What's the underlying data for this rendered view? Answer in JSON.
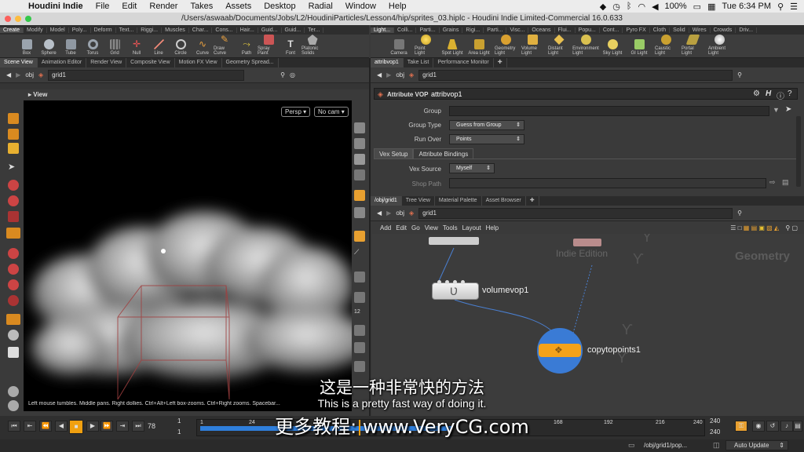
{
  "menubar": {
    "apple": "",
    "app": "Houdini Indie",
    "items": [
      "File",
      "Edit",
      "Render",
      "Takes",
      "Assets",
      "Desktop",
      "Radial",
      "Window",
      "Help"
    ],
    "battery": "100%",
    "time": "Tue 6:34 PM"
  },
  "title": "/Users/aswaab/Documents/Jobs/L2/HoudiniParticles/Lesson4/hip/sprites_03.hiplc - Houdini Indie Limited-Commercial 16.0.633",
  "left_shelf": {
    "tabs": [
      "Create",
      "Modify",
      "Model",
      "Poly...",
      "Deform",
      "Text...",
      "Riggi...",
      "Muscles",
      "Char...",
      "Cons...",
      "Hair...",
      "Guid...",
      "Guid...",
      "Ter..."
    ],
    "tools": [
      "Box",
      "Sphere",
      "Tube",
      "Torus",
      "Grid",
      "Null",
      "Line",
      "Circle",
      "Curve",
      "Draw Curve",
      "Path",
      "Spray Paint",
      "Font",
      "Platonic Solids"
    ]
  },
  "right_shelf": {
    "tabs": [
      "Light...",
      "Colli...",
      "Parti...",
      "Grains",
      "Rigi...",
      "Parti...",
      "Visc...",
      "Oceans",
      "Flui...",
      "Popu...",
      "Cont...",
      "Pyro FX",
      "Cloth",
      "Solid",
      "Wires",
      "Crowds",
      "Driv..."
    ],
    "tools": [
      "Camera",
      "Point Light",
      "Spot Light",
      "Area Light",
      "Geometry Light",
      "Volume Light",
      "Distant Light",
      "Environment Light",
      "Sky Light",
      "GI Light",
      "Caustic Light",
      "Portal Light",
      "Ambient Light"
    ]
  },
  "scene_tabs": [
    "Scene View",
    "Animation Editor",
    "Render View",
    "Composite View",
    "Motion FX View",
    "Geometry Spread..."
  ],
  "scene_path": {
    "obj": "obj",
    "node": "grid1"
  },
  "viewport": {
    "label": "View",
    "persp": "Persp",
    "cam": "No cam",
    "status": "Left mouse tumbles. Middle pans. Right dollies. Ctrl+Alt+Left box-zooms. Ctrl+Right zooms. Spacebar..."
  },
  "param_tabs": [
    "attribvop1",
    "Take List",
    "Performance Monitor"
  ],
  "param_path": {
    "obj": "obj",
    "node": "grid1"
  },
  "params": {
    "node_type": "Attribute VOP",
    "node_name": "attribvop1",
    "group_label": "Group",
    "group_value": "",
    "group_type_label": "Group Type",
    "group_type_value": "Guess from Group",
    "run_over_label": "Run Over",
    "run_over_value": "Points",
    "subtabs": [
      "Vex Setup",
      "Attribute Bindings"
    ],
    "vex_source_label": "Vex Source",
    "vex_source_value": "Myself",
    "shop_path_label": "Shop Path",
    "shop_path_value": ""
  },
  "net_tabs": [
    "/obj/grid1",
    "Tree View",
    "Material Palette",
    "Asset Browser"
  ],
  "net_path": {
    "obj": "obj",
    "node": "grid1"
  },
  "net_menu": [
    "Add",
    "Edit",
    "Go",
    "View",
    "Tools",
    "Layout",
    "Help"
  ],
  "network": {
    "watermark_edition": "Indie Edition",
    "watermark_context": "Geometry",
    "nodes": [
      {
        "name": "volumevop1"
      },
      {
        "name": "copytopoints1"
      }
    ]
  },
  "timeline": {
    "current_frame": "78",
    "start": "1",
    "start2": "1",
    "ticks": [
      "1",
      "24",
      "168",
      "192",
      "216",
      "240"
    ],
    "end": "240",
    "end2": "240",
    "auto_update": "Auto Update",
    "status_path": "/obj/grid1/pop..."
  },
  "subtitles": {
    "chinese": "这是一种非常快的方法",
    "english": "This is a pretty fast way of doing it.",
    "watermark": "更多教程: www.VeryCG.com"
  },
  "colors": {
    "node_selected": "#f4a21a",
    "node_ring": "#3a7bd5",
    "timebar": "#2f7fdc",
    "play": "#f0a010"
  }
}
